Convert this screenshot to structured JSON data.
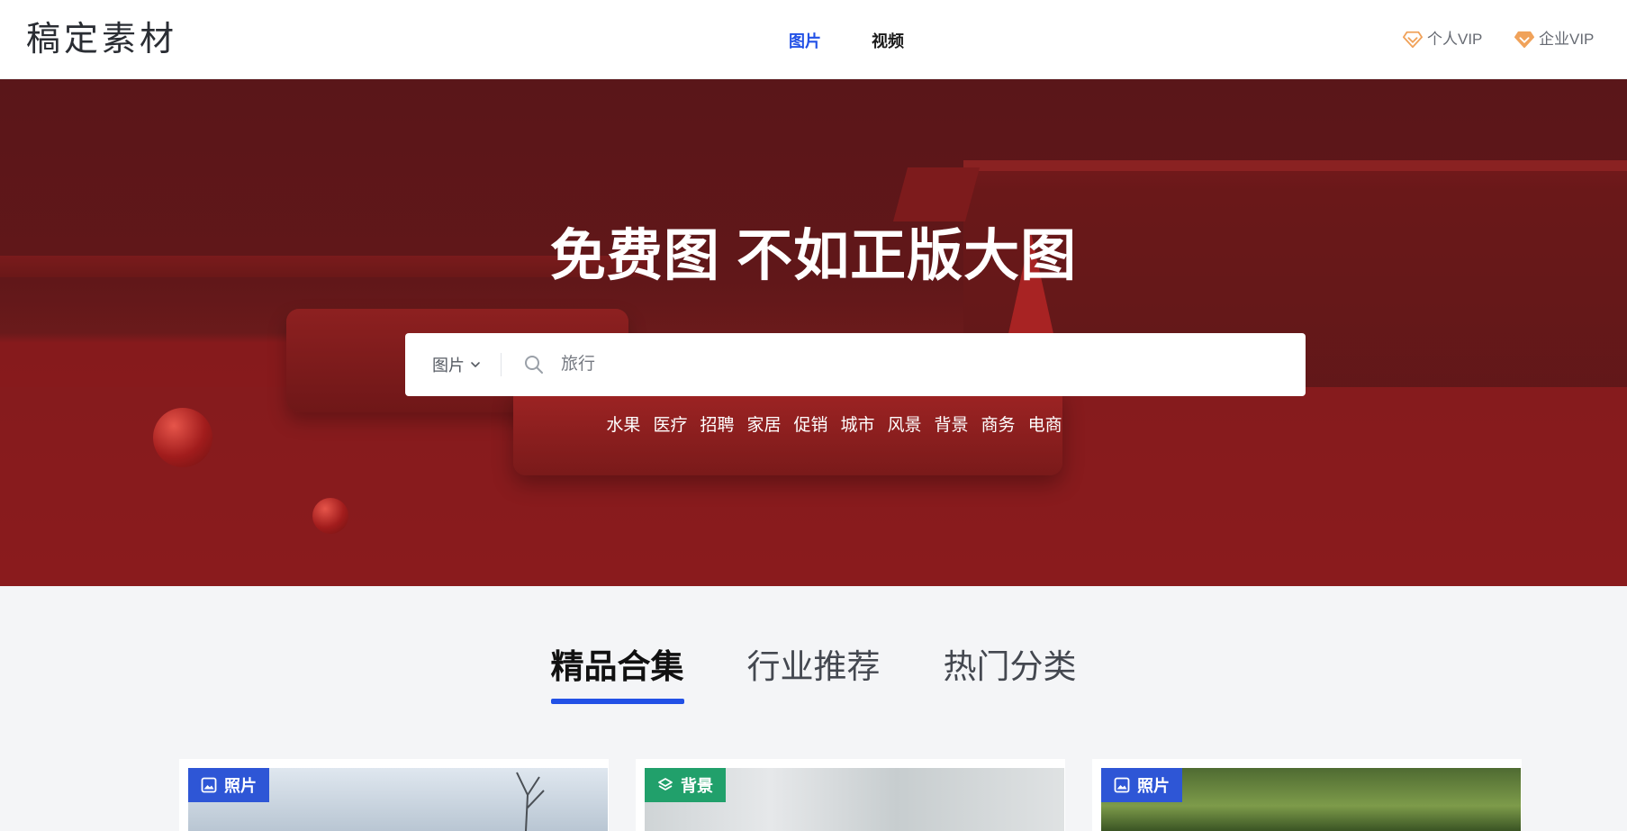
{
  "header": {
    "logo": "稿定素材",
    "nav": [
      {
        "label": "图片",
        "active": true
      },
      {
        "label": "视频",
        "active": false
      }
    ],
    "vip_personal": "个人VIP",
    "vip_enterprise": "企业VIP",
    "accent_color": "#2251e6",
    "vip_icon": "diamond-icon"
  },
  "hero": {
    "title": "免费图 不如正版大图",
    "search": {
      "type_label": "图片",
      "placeholder": "旅行"
    },
    "hot_tags": [
      "水果",
      "医疗",
      "招聘",
      "家居",
      "促销",
      "城市",
      "风景",
      "背景",
      "商务",
      "电商"
    ]
  },
  "section": {
    "tabs": [
      {
        "label": "精品合集",
        "active": true
      },
      {
        "label": "行业推荐",
        "active": false
      },
      {
        "label": "热门分类",
        "active": false
      }
    ]
  },
  "cards": [
    {
      "badge": "照片",
      "badge_icon": "image-icon",
      "badge_color": "#2e56d6"
    },
    {
      "badge": "背景",
      "badge_icon": "layers-icon",
      "badge_color": "#21a06b"
    },
    {
      "badge": "照片",
      "badge_icon": "image-icon",
      "badge_color": "#2e56d6"
    }
  ]
}
